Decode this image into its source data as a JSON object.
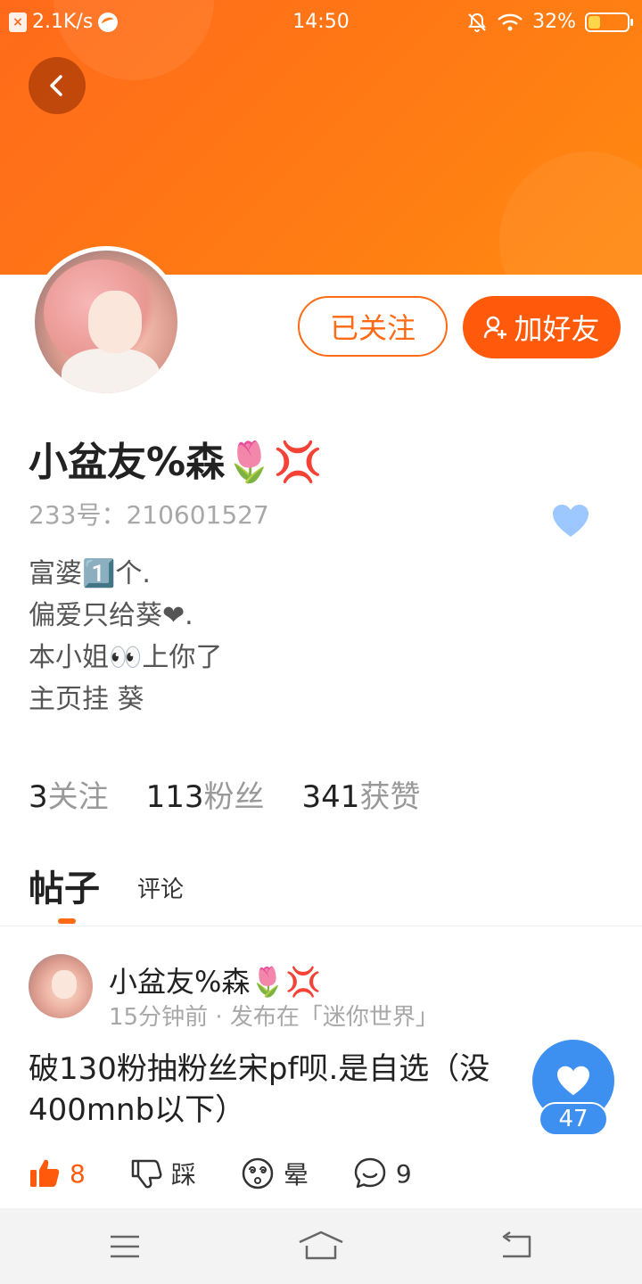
{
  "status_bar": {
    "net_speed": "2.1K/s",
    "time": "14:50",
    "battery_percent": "32%",
    "battery_level": 0.32
  },
  "profile": {
    "name": "小盆友%森🌷💢",
    "id_label": "233号：",
    "id_value": "210601527",
    "followed_label": "已关注",
    "add_friend_label": "加好友",
    "bio_lines": [
      "富婆1️⃣个.",
      "偏爱只给葵❤.",
      "本小姐👀上你了",
      "主页挂 葵"
    ]
  },
  "stats": [
    {
      "num": "3",
      "label": "关注"
    },
    {
      "num": "113",
      "label": "粉丝"
    },
    {
      "num": "341",
      "label": "获赞"
    }
  ],
  "tabs": [
    {
      "label": "帖子",
      "active": true
    },
    {
      "label": "评论",
      "active": false
    }
  ],
  "post": {
    "author": "小盆友%森🌷💢",
    "meta": "15分钟前 · 发布在「迷你世界」",
    "text": "破130粉抽粉丝宋pf呗.是自选（没400mnb以下）",
    "float_like_count": "47",
    "actions": {
      "like_count": "8",
      "dislike_label": "踩",
      "dizzy_label": "晕",
      "comment_count": "9"
    }
  },
  "colors": {
    "brand_orange": "#ff6a14",
    "accent_blue": "#3d8ff0",
    "heart_light_blue": "#9cc8ff"
  }
}
